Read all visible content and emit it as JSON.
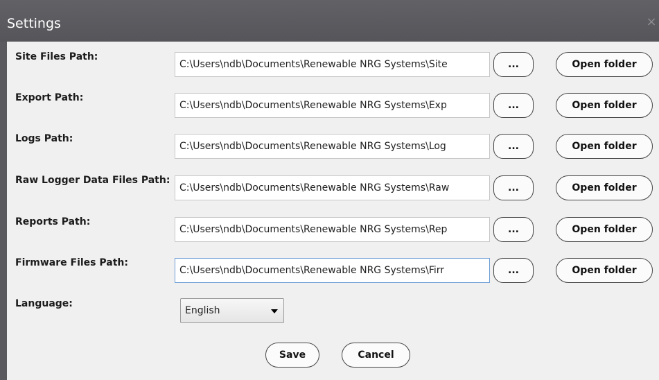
{
  "window": {
    "title": "Settings",
    "close_glyph": "×"
  },
  "paths": [
    {
      "label": "Site Files Path:",
      "value": "C:\\Users\\ndb\\Documents\\Renewable NRG Systems\\Site"
    },
    {
      "label": "Export Path:",
      "value": "C:\\Users\\ndb\\Documents\\Renewable NRG Systems\\Exp"
    },
    {
      "label": "Logs Path:",
      "value": "C:\\Users\\ndb\\Documents\\Renewable NRG Systems\\Log"
    },
    {
      "label": "Raw Logger Data Files Path:",
      "value": "C:\\Users\\ndb\\Documents\\Renewable NRG Systems\\Raw"
    },
    {
      "label": "Reports Path:",
      "value": "C:\\Users\\ndb\\Documents\\Renewable NRG Systems\\Rep"
    },
    {
      "label": "Firmware Files Path:",
      "value": "C:\\Users\\ndb\\Documents\\Renewable NRG Systems\\Firr"
    }
  ],
  "buttons": {
    "browse": "...",
    "open_folder": "Open folder",
    "save": "Save",
    "cancel": "Cancel"
  },
  "language": {
    "label": "Language:",
    "selected": "English"
  },
  "colors": {
    "titlebar": "#5a5a5e",
    "panel": "#f0f0f0",
    "focus_border": "#6e9fd6"
  }
}
